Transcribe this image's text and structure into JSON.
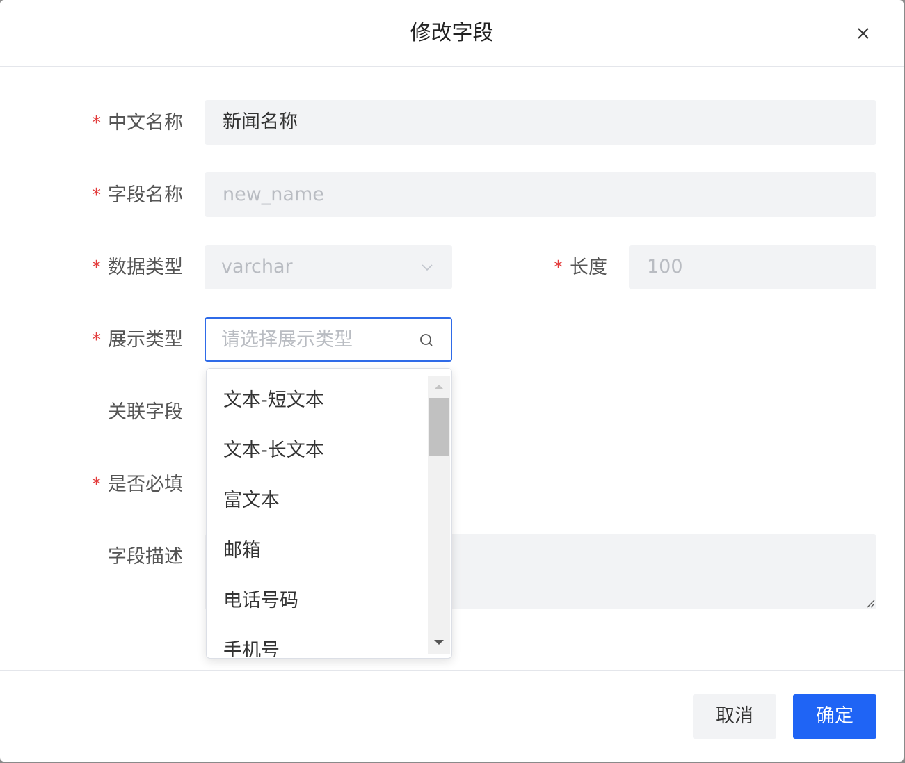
{
  "dialog": {
    "title": "修改字段"
  },
  "form": {
    "required_mark": "*",
    "cn_name": {
      "label": "中文名称",
      "value": "新闻名称"
    },
    "field_name": {
      "label": "字段名称",
      "value": "new_name"
    },
    "data_type": {
      "label": "数据类型",
      "value": "varchar"
    },
    "length": {
      "label": "长度",
      "value": "100"
    },
    "display_type": {
      "label": "展示类型",
      "placeholder": "请选择展示类型"
    },
    "related_field": {
      "label": "关联字段"
    },
    "required": {
      "label": "是否必填"
    },
    "description": {
      "label": "字段描述"
    }
  },
  "dropdown": {
    "options": [
      "文本-短文本",
      "文本-长文本",
      "富文本",
      "邮箱",
      "电话号码",
      "手机号"
    ]
  },
  "footer": {
    "cancel_label": "取消",
    "ok_label": "确定"
  },
  "colors": {
    "accent": "#1f64f5",
    "required": "#e33b3b",
    "field_bg": "#f2f3f5"
  },
  "icons": [
    "close-icon",
    "chevron-down-icon",
    "search-icon",
    "resize-handle-icon",
    "scroll-up-arrow-icon",
    "scroll-down-arrow-icon"
  ]
}
